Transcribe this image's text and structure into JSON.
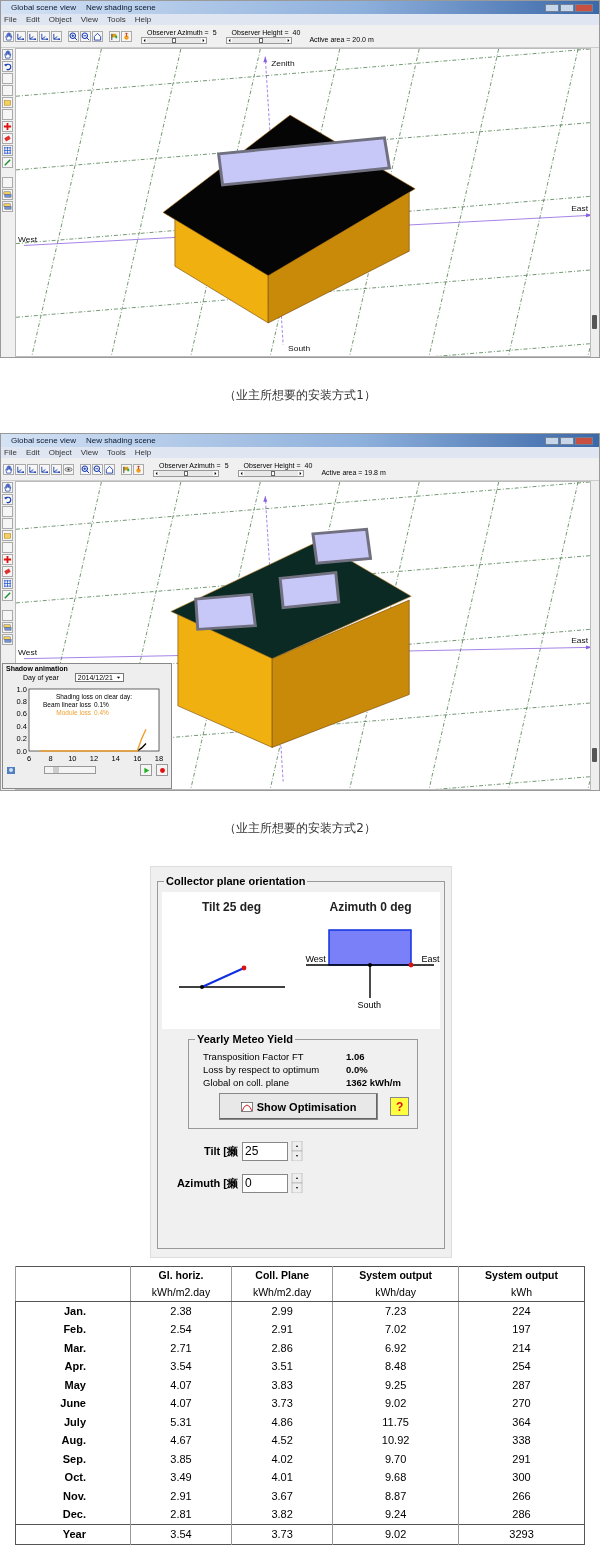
{
  "scenes": [
    {
      "kind": "single-array",
      "window": {
        "title": "Global scene view",
        "document": "New shading scene"
      },
      "menu": [
        "File",
        "Edit",
        "Object",
        "View",
        "Tools",
        "Help"
      ],
      "sliders": [
        {
          "label": "Observer Azimuth =",
          "value": "5",
          "level": 0.5
        },
        {
          "label": "Observer Height =",
          "value": "40",
          "level": 0.55
        }
      ],
      "active_area": "Active area = 20.0 m",
      "axis_labels": [
        {
          "kind": "zenith",
          "text": "Zenith"
        },
        {
          "kind": "east",
          "text": "East"
        },
        {
          "kind": "west",
          "text": "West"
        },
        {
          "kind": "south",
          "text": "South"
        }
      ],
      "caption": "（业主所想要的安装方式1）"
    },
    {
      "kind": "three-arrays",
      "window": {
        "title": "Global scene view",
        "document": "New shading scene"
      },
      "menu": [
        "File",
        "Edit",
        "Object",
        "View",
        "Tools",
        "Help"
      ],
      "sliders": [
        {
          "label": "Observer Azimuth =",
          "value": "5",
          "level": 0.5
        },
        {
          "label": "Observer Height =",
          "value": "40",
          "level": 0.55
        }
      ],
      "active_area": "Active area = 19.8 m",
      "axis_labels": [
        {
          "kind": "east",
          "text": "East"
        },
        {
          "kind": "west",
          "text": "West"
        }
      ],
      "shadow_animation": {
        "title": "Shadow animation",
        "day_label": "Day of year",
        "day_value": "2014/12/21",
        "chart_data": {
          "type": "line",
          "title": "Shading loss on clear day:",
          "x": [
            7,
            8,
            9,
            10,
            11,
            12,
            13,
            14,
            15,
            16,
            16.4,
            16.8
          ],
          "series": [
            {
              "name": "Beam linear loss",
              "color": "#000000",
              "values": [
                null,
                null,
                null,
                null,
                null,
                null,
                null,
                null,
                null,
                0,
                0.05,
                0.12
              ]
            },
            {
              "name": "Module loss",
              "color": "#f0a030",
              "values": [
                0,
                0,
                0,
                0,
                0,
                0,
                0,
                0,
                0,
                0,
                0.2,
                0.35
              ]
            }
          ],
          "xlim": [
            6,
            18
          ],
          "ylim": [
            0,
            1
          ],
          "xticks": [
            6,
            8,
            10,
            12,
            14,
            16,
            18
          ],
          "yticks": [
            {
              "value": 0,
              "label": "0.0"
            },
            {
              "value": 0.2,
              "label": "0.2"
            },
            {
              "value": 0.4,
              "label": "0.4"
            },
            {
              "value": 0.6,
              "label": "0.6"
            },
            {
              "value": 0.8,
              "label": "0.8"
            },
            {
              "value": 1,
              "label": "1.0"
            }
          ],
          "annotations": [
            "0.1%",
            "0.4%"
          ]
        }
      },
      "caption": "（业主所想要的安装方式2）"
    }
  ],
  "orientation": {
    "title": "Collector plane orientation",
    "tilt_heading": "Tilt 25 deg",
    "azimuth_heading": "Azimuth 0 deg",
    "west": "West",
    "east": "East",
    "south": "South",
    "yield": {
      "title": "Yearly Meteo Yield",
      "rows": [
        {
          "label": "Transposition Factor FT",
          "value": "1.06"
        },
        {
          "label": "Loss by respect to optimum",
          "value": "0.0%"
        },
        {
          "label": "Global  on coll. plane",
          "value": "1362 kWh/m"
        }
      ],
      "button": "Show Optimisation",
      "help": "?"
    },
    "fields": [
      {
        "label": "Tilt [癩",
        "value": "25"
      },
      {
        "label": "Azimuth [癩",
        "value": "0"
      }
    ]
  },
  "table": {
    "columns": [
      {
        "title": "Gl. horiz.",
        "unit": "kWh/m2.day"
      },
      {
        "title": "Coll. Plane",
        "unit": "kWh/m2.day"
      },
      {
        "title": "System output",
        "unit": "kWh/day"
      },
      {
        "title": "System output",
        "unit": "kWh"
      }
    ],
    "rows": [
      {
        "label": "Jan.",
        "values": [
          "2.38",
          "2.99",
          "7.23",
          "224"
        ]
      },
      {
        "label": "Feb.",
        "values": [
          "2.54",
          "2.91",
          "7.02",
          "197"
        ]
      },
      {
        "label": "Mar.",
        "values": [
          "2.71",
          "2.86",
          "6.92",
          "214"
        ]
      },
      {
        "label": "Apr.",
        "values": [
          "3.54",
          "3.51",
          "8.48",
          "254"
        ]
      },
      {
        "label": "May",
        "values": [
          "4.07",
          "3.83",
          "9.25",
          "287"
        ]
      },
      {
        "label": "June",
        "values": [
          "4.07",
          "3.73",
          "9.02",
          "270"
        ]
      },
      {
        "label": "July",
        "values": [
          "5.31",
          "4.86",
          "11.75",
          "364"
        ]
      },
      {
        "label": "Aug.",
        "values": [
          "4.67",
          "4.52",
          "10.92",
          "338"
        ]
      },
      {
        "label": "Sep.",
        "values": [
          "3.85",
          "4.02",
          "9.70",
          "291"
        ]
      },
      {
        "label": "Oct.",
        "values": [
          "3.49",
          "4.01",
          "9.68",
          "300"
        ]
      },
      {
        "label": "Nov.",
        "values": [
          "2.91",
          "3.67",
          "8.87",
          "266"
        ]
      },
      {
        "label": "Dec.",
        "values": [
          "2.81",
          "3.82",
          "9.24",
          "286"
        ]
      }
    ],
    "total": {
      "label": "Year",
      "values": [
        "3.54",
        "3.73",
        "9.02",
        "3293"
      ]
    }
  }
}
